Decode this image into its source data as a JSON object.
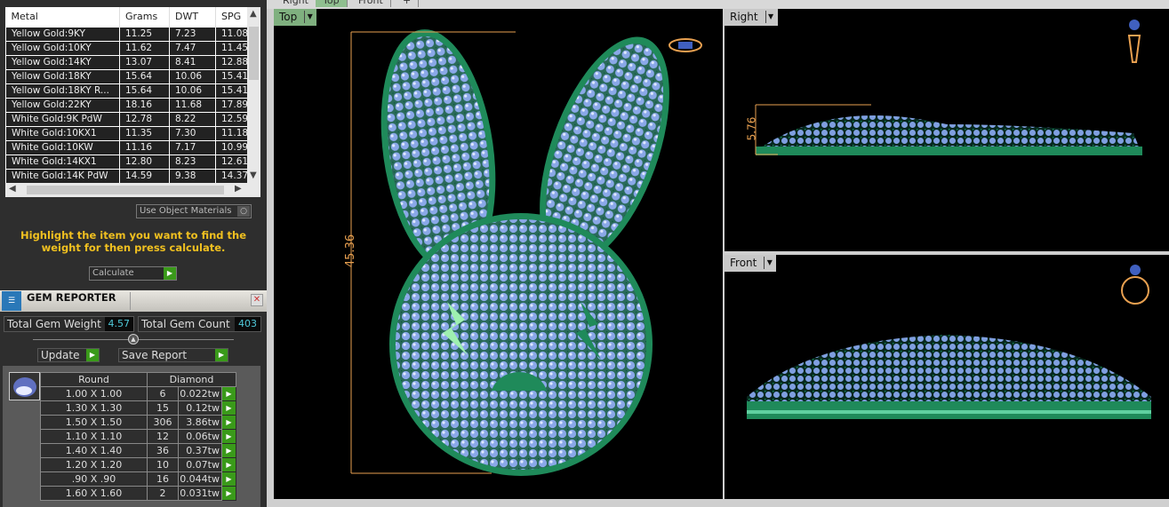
{
  "metal_table": {
    "headers": [
      "Metal",
      "Grams",
      "DWT",
      "SPG"
    ],
    "rows": [
      [
        "Yellow Gold:9KY",
        "11.25",
        "7.23",
        "11.08"
      ],
      [
        "Yellow Gold:10KY",
        "11.62",
        "7.47",
        "11.45"
      ],
      [
        "Yellow Gold:14KY",
        "13.07",
        "8.41",
        "12.88"
      ],
      [
        "Yellow Gold:18KY",
        "15.64",
        "10.06",
        "15.41"
      ],
      [
        "Yellow Gold:18KY R...",
        "15.64",
        "10.06",
        "15.41"
      ],
      [
        "Yellow Gold:22KY",
        "18.16",
        "11.68",
        "17.89"
      ],
      [
        "White Gold:9K PdW",
        "12.78",
        "8.22",
        "12.59"
      ],
      [
        "White Gold:10KX1",
        "11.35",
        "7.30",
        "11.18"
      ],
      [
        "White Gold:10KW",
        "11.16",
        "7.17",
        "10.99"
      ],
      [
        "White Gold:14KX1",
        "12.80",
        "8.23",
        "12.61"
      ],
      [
        "White Gold:14K PdW",
        "14.59",
        "9.38",
        "14.37"
      ]
    ]
  },
  "use_object_materials": "Use Object Materials",
  "hint": "Highlight the item you want to find the weight for then press calculate.",
  "calculate_label": "Calculate",
  "gem_reporter": {
    "title": "GEM REPORTER",
    "total_weight_label": "Total Gem Weight",
    "total_weight": "4.57",
    "total_count_label": "Total Gem Count",
    "total_count": "403",
    "update_label": "Update",
    "save_label": "Save Report",
    "shape": "Round",
    "material": "Diamond",
    "rows": [
      [
        "1.00 X 1.00",
        "6",
        "0.022tw"
      ],
      [
        "1.30 X 1.30",
        "15",
        "0.12tw"
      ],
      [
        "1.50 X 1.50",
        "306",
        "3.86tw"
      ],
      [
        "1.10 X 1.10",
        "12",
        "0.06tw"
      ],
      [
        "1.40 X 1.40",
        "36",
        "0.37tw"
      ],
      [
        "1.20 X 1.20",
        "10",
        "0.07tw"
      ],
      [
        ".90 X .90",
        "16",
        "0.044tw"
      ],
      [
        "1.60 X 1.60",
        "2",
        "0.031tw"
      ]
    ]
  },
  "view_tabs": [
    "Right",
    "Top",
    "Front",
    "+"
  ],
  "viewports": {
    "top": {
      "label": "Top",
      "dimension": "45.36"
    },
    "right": {
      "label": "Right",
      "dimension": "5.76"
    },
    "front": {
      "label": "Front"
    }
  },
  "colors": {
    "dimension": "#e8a050",
    "metal": "#1f8a5a",
    "gem": "#8aa8e8",
    "go": "#3a9a1a"
  }
}
